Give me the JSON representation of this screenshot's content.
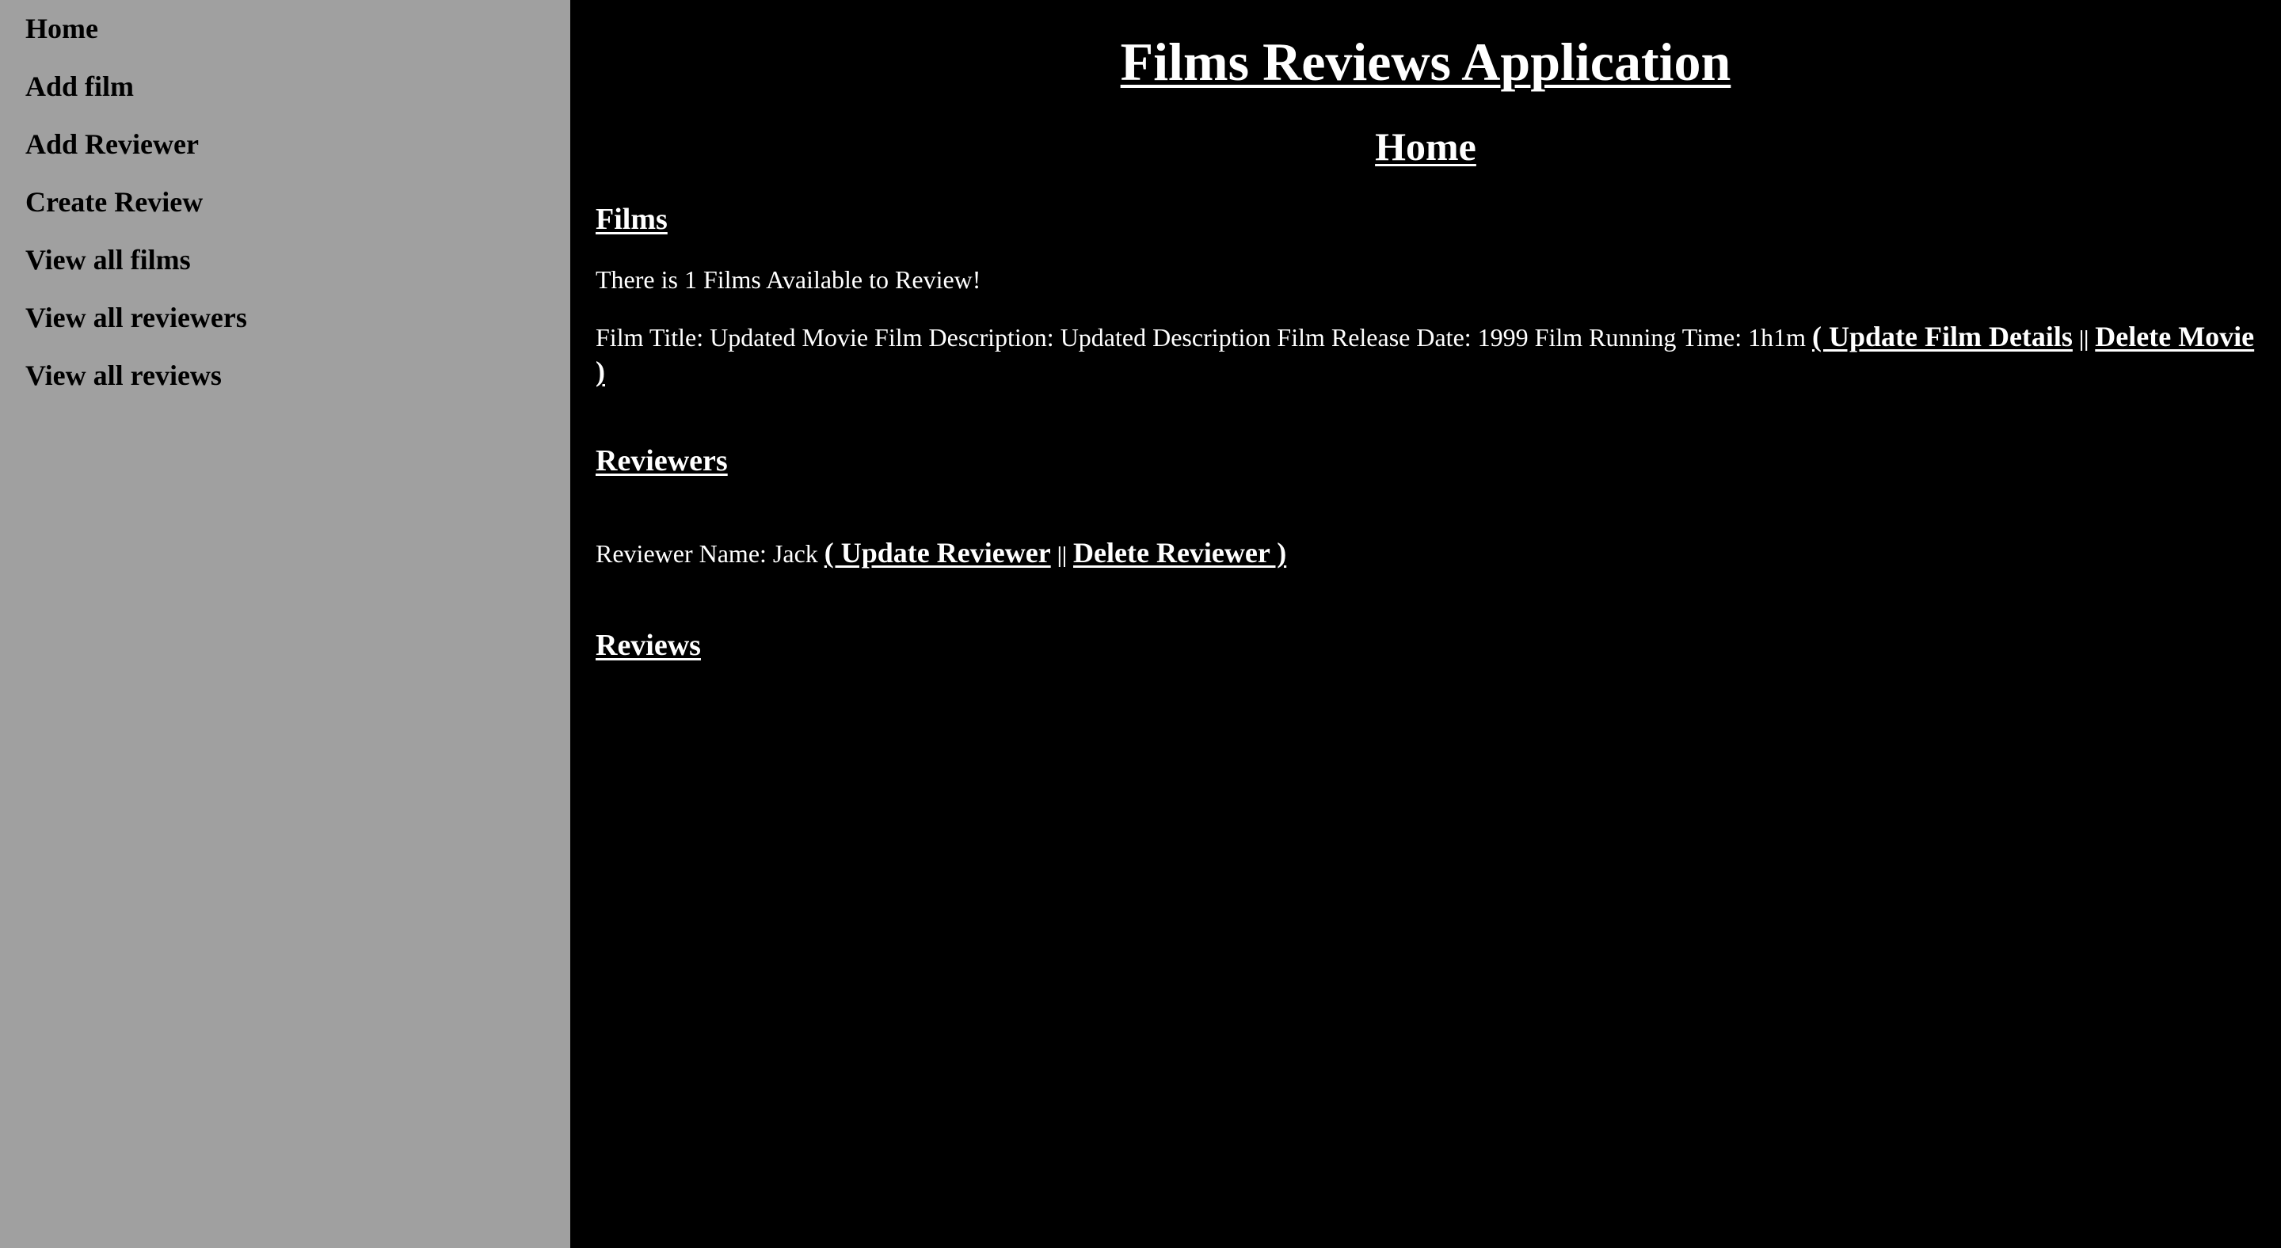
{
  "sidebar": {
    "items": [
      {
        "label": "Home"
      },
      {
        "label": "Add film"
      },
      {
        "label": "Add Reviewer"
      },
      {
        "label": "Create Review"
      },
      {
        "label": "View all films"
      },
      {
        "label": "View all reviewers"
      },
      {
        "label": "View all reviews"
      }
    ]
  },
  "main": {
    "app_title": "Films Reviews Application",
    "page_title": "Home",
    "films": {
      "heading": "Films",
      "summary": "There is 1 Films Available to Review!",
      "entry": {
        "text": "Film Title: Updated Movie Film Description: Updated Description Film Release Date: 1999 Film Running Time: 1h1m",
        "update_link": "( Update Film Details",
        "separator": "||",
        "delete_link": "Delete Movie )"
      }
    },
    "reviewers": {
      "heading": "Reviewers",
      "entry": {
        "text": "Reviewer Name: Jack",
        "update_link": "( Update Reviewer",
        "separator": "||",
        "delete_link": "Delete Reviewer )"
      }
    },
    "reviews": {
      "heading": "Reviews"
    }
  },
  "colors": {
    "sidebar_bg": "#a0a0a0",
    "main_bg": "#000000",
    "main_text": "#ffffff",
    "sidebar_text": "#000000"
  }
}
